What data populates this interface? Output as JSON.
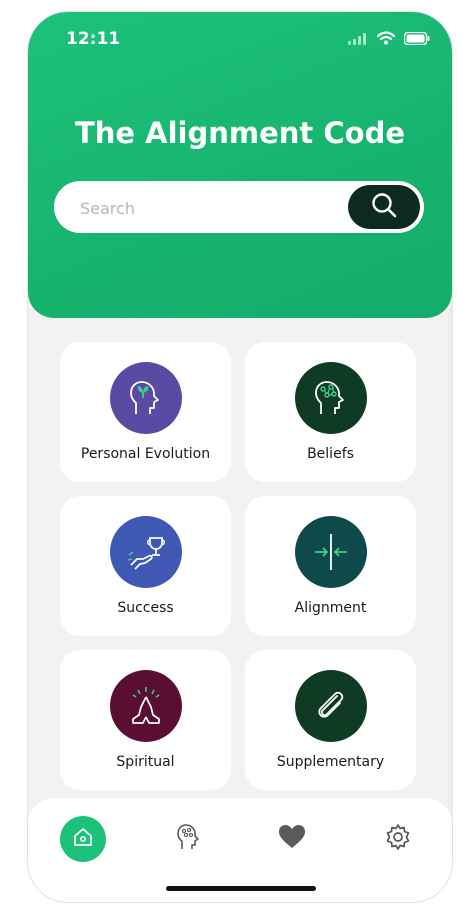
{
  "status": {
    "time": "12:11"
  },
  "app": {
    "title": "The Alignment Code"
  },
  "search": {
    "placeholder": "Search",
    "value": ""
  },
  "categories": [
    {
      "label": "Personal Evolution",
      "icon": "head-sprout-icon",
      "color": "#5b4aa3"
    },
    {
      "label": "Beliefs",
      "icon": "head-brain-icon",
      "color": "#0f3b24"
    },
    {
      "label": "Success",
      "icon": "trophy-hand-icon",
      "color": "#3f58b3"
    },
    {
      "label": "Alignment",
      "icon": "align-arrows-icon",
      "color": "#0e4a4a"
    },
    {
      "label": "Spiritual",
      "icon": "praying-hands-icon",
      "color": "#5a0f32"
    },
    {
      "label": "Supplementary",
      "icon": "paperclip-icon",
      "color": "#0f3b24"
    }
  ],
  "nav": {
    "items": [
      {
        "icon": "home-icon",
        "active": true
      },
      {
        "icon": "brain-head-icon",
        "active": false
      },
      {
        "icon": "heart-icon",
        "active": false
      },
      {
        "icon": "settings-icon",
        "active": false
      }
    ]
  },
  "colors": {
    "brand": "#1dc27a",
    "dark": "#0d2a1f",
    "background": "#f2f2f2"
  }
}
